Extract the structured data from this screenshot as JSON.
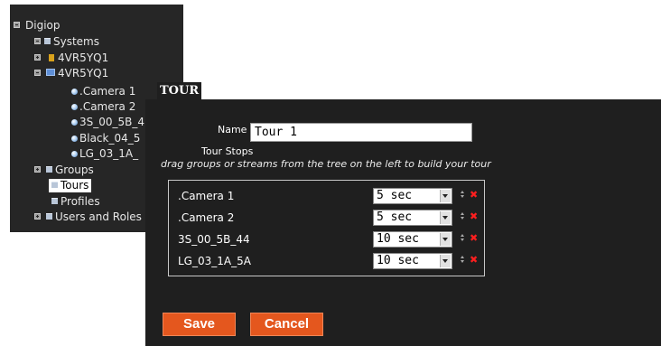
{
  "tree": {
    "root": "Digiop",
    "systems": "Systems",
    "system1": "4VR5YQ1",
    "system2": "4VR5YQ1",
    "cameras": [
      ".Camera 1",
      ".Camera 2",
      "3S_00_5B_4",
      "Black_04_5",
      "LG_03_1A_"
    ],
    "groups": "Groups",
    "tours": "Tours",
    "profiles": "Profiles",
    "users": "Users and Roles"
  },
  "tour": {
    "title": "TOUR",
    "name_label": "Name",
    "name_value": "Tour 1",
    "stops_label": "Tour Stops",
    "hint": "drag groups or streams from the tree on the left to build your tour",
    "stops": [
      {
        "name": ".Camera 1",
        "duration": "5 sec"
      },
      {
        "name": ".Camera 2",
        "duration": "5 sec"
      },
      {
        "name": "3S_00_5B_44",
        "duration": "10 sec"
      },
      {
        "name": "LG_03_1A_5A",
        "duration": "10 sec"
      }
    ],
    "delete_glyph": "✖",
    "save_label": "Save",
    "cancel_label": "Cancel"
  },
  "colors": {
    "accent": "#e4571e",
    "panel": "#1f1f1f",
    "tree_bg": "#262626",
    "delete": "#ff1f1f"
  }
}
